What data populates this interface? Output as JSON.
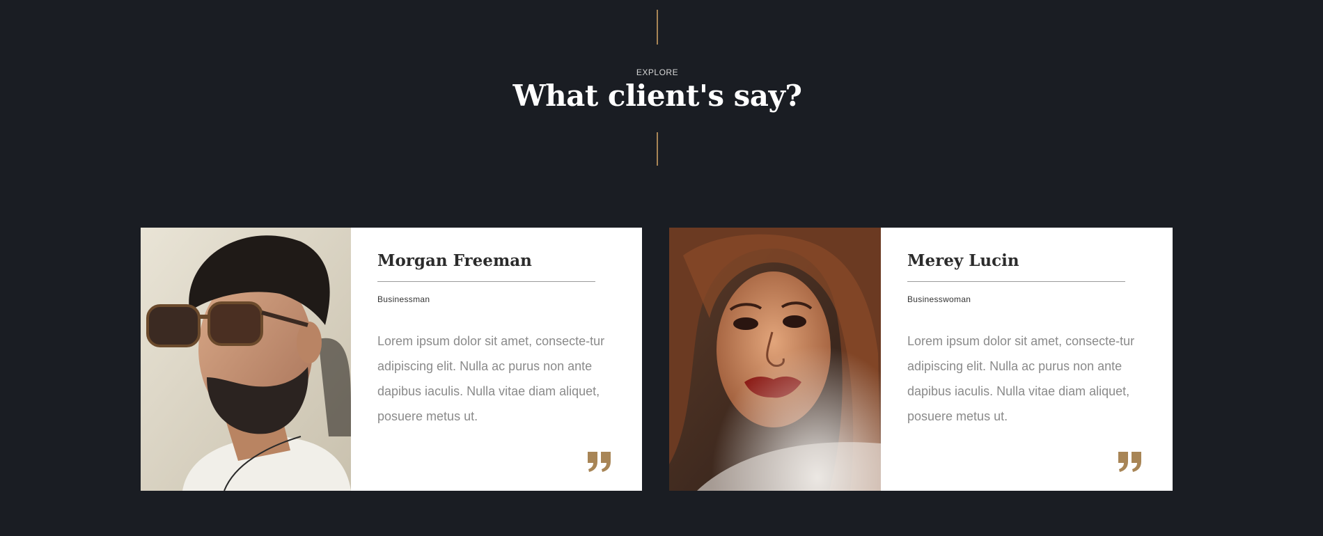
{
  "section": {
    "eyebrow": "EXPLORE",
    "title": "What client's say?"
  },
  "accent_color": "#a88556",
  "background_color": "#1a1d23",
  "testimonials": [
    {
      "name": "Morgan Freeman",
      "role": "Businessman",
      "text": "Lorem ipsum dolor sit amet, consecte-tur adipiscing elit. Nulla ac purus non ante dapibus iaculis. Nulla vitae diam aliquet, posuere metus ut.",
      "photo_icon": "man-with-sunglasses-photo",
      "quote_icon": "closing-quote-icon"
    },
    {
      "name": "Merey Lucin",
      "role": "Businesswoman",
      "text": "Lorem ipsum dolor sit amet, consecte-tur adipiscing elit. Nulla ac purus non ante dapibus iaculis. Nulla vitae diam aliquet, posuere metus ut.",
      "photo_icon": "woman-portrait-photo",
      "quote_icon": "closing-quote-icon"
    }
  ]
}
